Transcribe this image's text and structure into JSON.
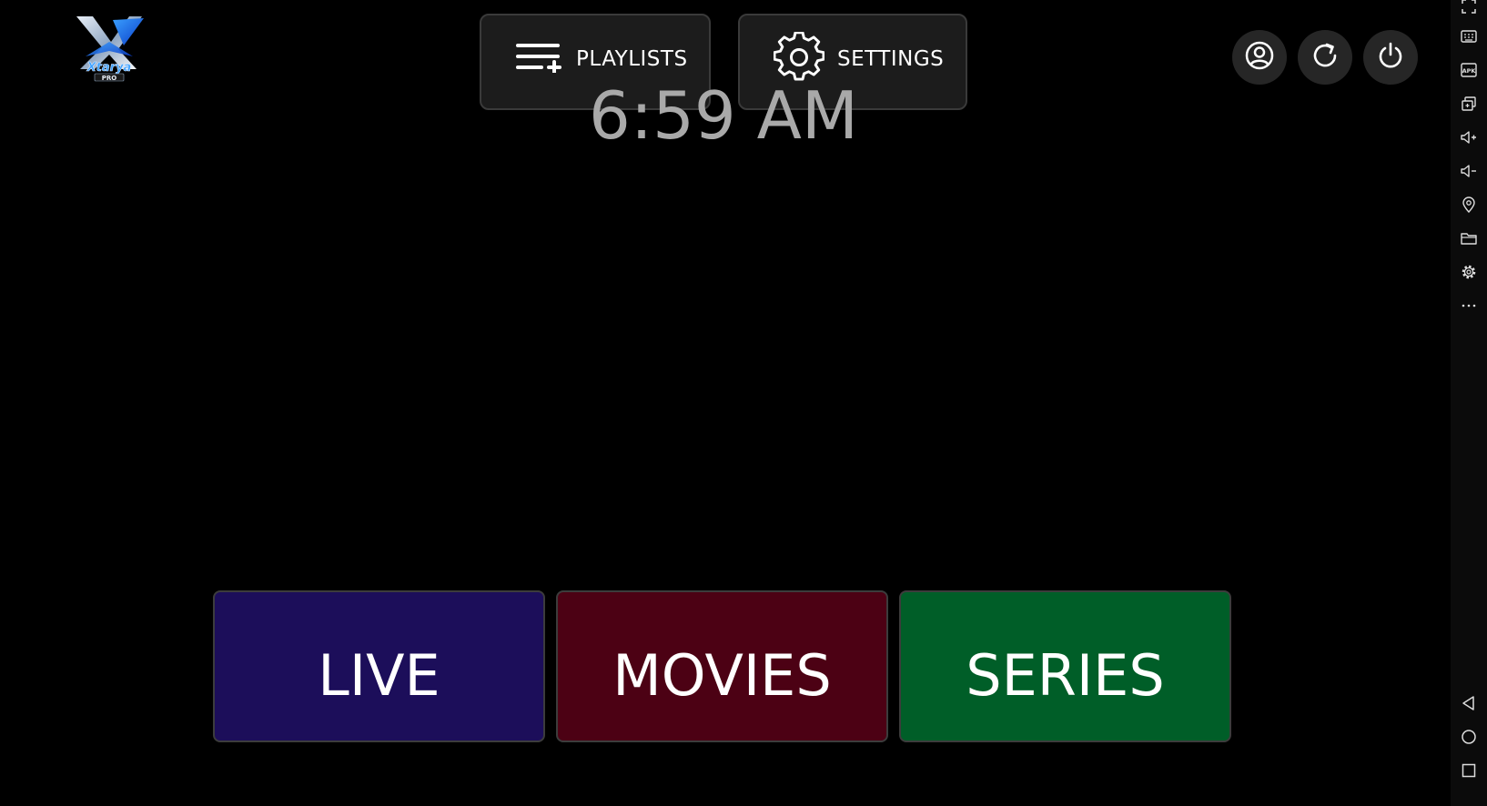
{
  "header": {
    "playlists_label": "PLAYLISTS",
    "settings_label": "SETTINGS",
    "clock": "6:59 AM"
  },
  "logo": {
    "icon": "xtream-pro-logo-icon",
    "text_main": "Xtarya",
    "text_sub": "PRO"
  },
  "actions": [
    {
      "icon": "profile-icon"
    },
    {
      "icon": "refresh-icon"
    },
    {
      "icon": "power-icon"
    }
  ],
  "tiles": {
    "live": "LIVE",
    "movies": "MOVIES",
    "series": "SERIES"
  },
  "colors": {
    "live": "#1c0e5a",
    "movies": "#4c0114",
    "series": "#005e28",
    "clock": "#a9a9a9"
  },
  "toolbar": {
    "icons": [
      "fullscreen-icon",
      "keyboard-icon",
      "apk-icon",
      "multi-window-icon",
      "volume-up-icon",
      "volume-down-icon",
      "location-icon",
      "folder-icon",
      "gear-icon",
      "more-icon",
      "back-icon",
      "home-icon",
      "recents-icon"
    ],
    "apk_label": "APK"
  }
}
